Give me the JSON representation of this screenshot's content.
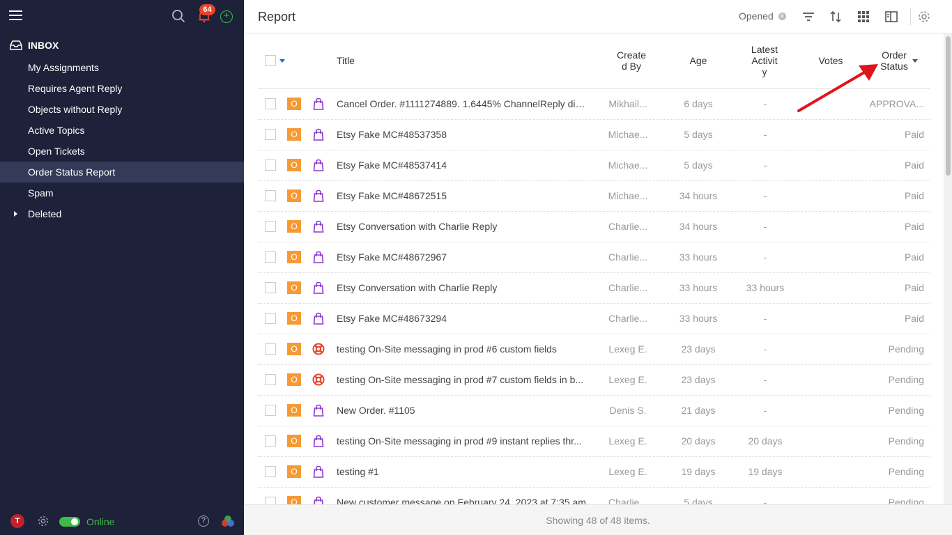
{
  "sidebar": {
    "notification_count": "64",
    "inbox_label": "INBOX",
    "items": [
      {
        "label": "My Assignments"
      },
      {
        "label": "Requires Agent Reply"
      },
      {
        "label": "Objects without Reply"
      },
      {
        "label": "Active Topics"
      },
      {
        "label": "Open Tickets"
      },
      {
        "label": "Order Status Report"
      },
      {
        "label": "Spam"
      },
      {
        "label": "Deleted"
      }
    ],
    "active_index": 5,
    "avatar_initial": "T",
    "status_label": "Online"
  },
  "header": {
    "title": "Report",
    "filter_chip": "Opened"
  },
  "table": {
    "columns": {
      "title": "Title",
      "created_by": "Create\nd By",
      "age": "Age",
      "latest_activity": "Latest\nActivit\ny",
      "votes": "Votes",
      "order_status": "Order\nStatus"
    },
    "rows": [
      {
        "badge": "O",
        "icon": "bag-icon",
        "title": "Cancel Order. #1111274889. 1.6445% ChannelReply dis...",
        "created_by": "Mikhail...",
        "age": "6 days",
        "latest": "-",
        "votes": "",
        "status": "APPROVA..."
      },
      {
        "badge": "O",
        "icon": "bag-icon",
        "title": "Etsy Fake MC#48537358",
        "created_by": "Michae...",
        "age": "5 days",
        "latest": "-",
        "votes": "",
        "status": "Paid"
      },
      {
        "badge": "O",
        "icon": "bag-icon",
        "title": "Etsy Fake MC#48537414",
        "created_by": "Michae...",
        "age": "5 days",
        "latest": "-",
        "votes": "",
        "status": "Paid"
      },
      {
        "badge": "O",
        "icon": "bag-icon",
        "title": "Etsy Fake MC#48672515",
        "created_by": "Michae...",
        "age": "34 hours",
        "latest": "-",
        "votes": "",
        "status": "Paid"
      },
      {
        "badge": "O",
        "icon": "bag-icon",
        "title": "Etsy Conversation with Charlie Reply",
        "created_by": "Charlie...",
        "age": "34 hours",
        "latest": "-",
        "votes": "",
        "status": "Paid"
      },
      {
        "badge": "O",
        "icon": "bag-icon",
        "title": "Etsy Fake MC#48672967",
        "created_by": "Charlie...",
        "age": "33 hours",
        "latest": "-",
        "votes": "",
        "status": "Paid"
      },
      {
        "badge": "O",
        "icon": "bag-icon",
        "title": "Etsy Conversation with Charlie Reply",
        "created_by": "Charlie...",
        "age": "33 hours",
        "latest": "33 hours",
        "votes": "",
        "status": "Paid"
      },
      {
        "badge": "O",
        "icon": "bag-icon",
        "title": "Etsy Fake MC#48673294",
        "created_by": "Charlie...",
        "age": "33 hours",
        "latest": "-",
        "votes": "",
        "status": "Paid"
      },
      {
        "badge": "O",
        "icon": "lifebuoy-icon",
        "title": "testing On-Site messaging in prod #6 custom fields",
        "created_by": "Lexeg E.",
        "age": "23 days",
        "latest": "-",
        "votes": "",
        "status": "Pending"
      },
      {
        "badge": "O",
        "icon": "lifebuoy-icon",
        "title": "testing On-Site messaging in prod #7 custom fields in b...",
        "created_by": "Lexeg E.",
        "age": "23 days",
        "latest": "-",
        "votes": "",
        "status": "Pending"
      },
      {
        "badge": "O",
        "icon": "bag-icon",
        "title": "New Order. #1105",
        "created_by": "Denis S.",
        "age": "21 days",
        "latest": "-",
        "votes": "",
        "status": "Pending"
      },
      {
        "badge": "O",
        "icon": "bag-icon",
        "title": "testing On-Site messaging in prod #9 instant replies thr...",
        "created_by": "Lexeg E.",
        "age": "20 days",
        "latest": "20 days",
        "votes": "",
        "status": "Pending"
      },
      {
        "badge": "O",
        "icon": "bag-icon",
        "title": "testing #1",
        "created_by": "Lexeg E.",
        "age": "19 days",
        "latest": "19 days",
        "votes": "",
        "status": "Pending"
      },
      {
        "badge": "O",
        "icon": "bag-icon",
        "title": "New customer message on February 24, 2023 at 7:35 am",
        "created_by": "Charlie...",
        "age": "5 days",
        "latest": "-",
        "votes": "",
        "status": "Pending"
      }
    ]
  },
  "footer": {
    "summary": "Showing 48 of 48 items."
  },
  "colors": {
    "sidebar_bg": "#1d2139",
    "active_item_bg": "#353a58",
    "badge_orange": "#f59a35",
    "bag_purple": "#8e35d6",
    "lifebuoy_red": "#e5452b",
    "online_green": "#3fbb4c",
    "arrow_red": "#e0141c"
  }
}
